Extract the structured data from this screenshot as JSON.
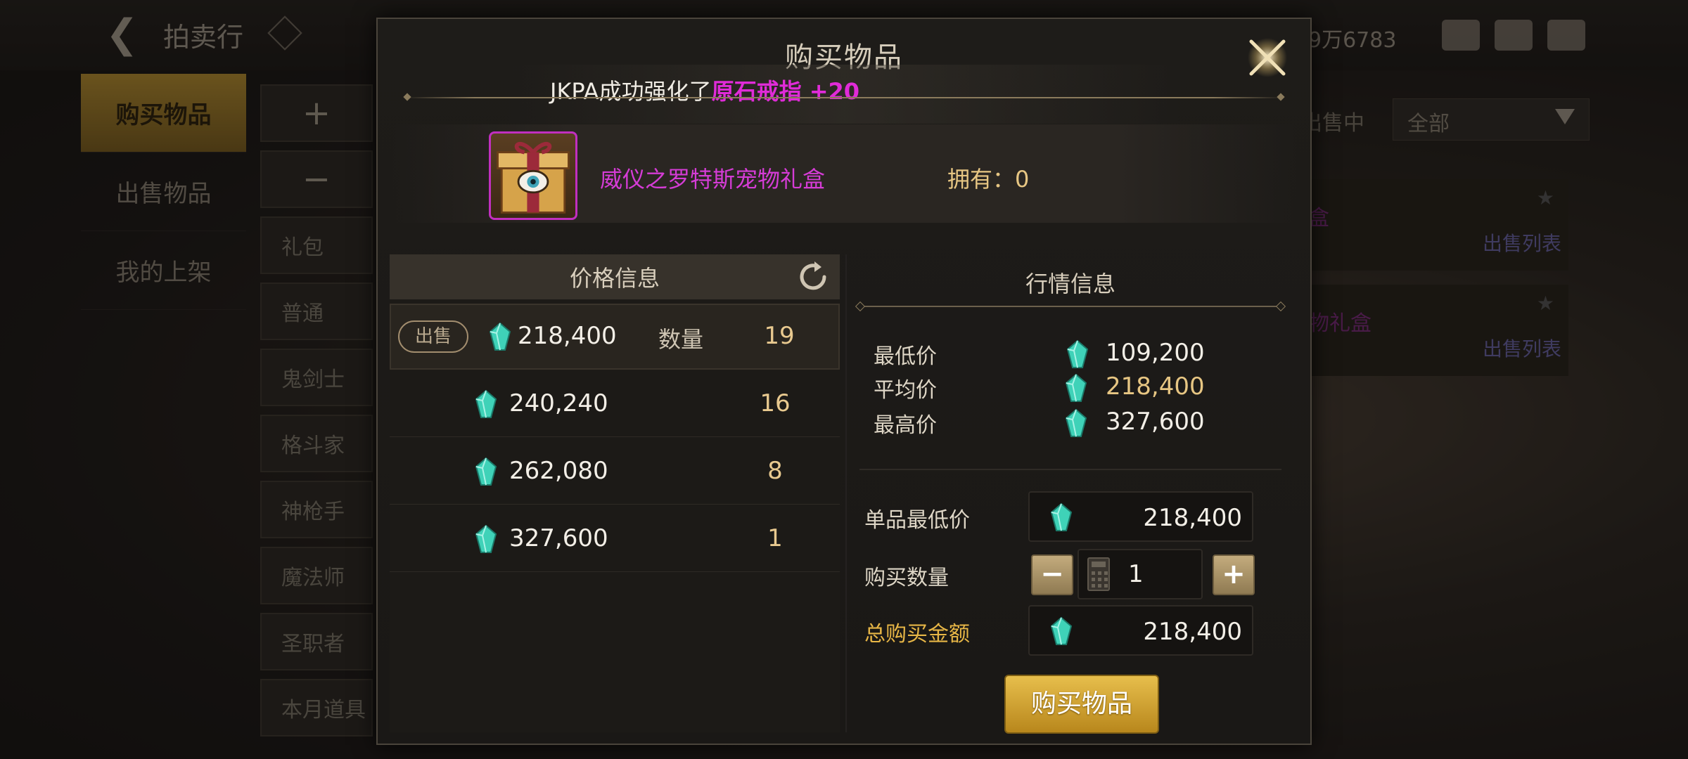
{
  "background": {
    "title": "拍卖行",
    "currency": "9万6783",
    "left_tabs": [
      "购买物品",
      "出售物品",
      "我的上架"
    ],
    "categories": [
      "+",
      "−",
      "礼包",
      "普通",
      "鬼剑士",
      "格斗家",
      "神枪手",
      "魔法师",
      "圣职者",
      "本月道具"
    ],
    "filter_label": "出售中",
    "filter_value": "全部",
    "rows": [
      {
        "name": "盒",
        "link": "出售列表"
      },
      {
        "name": "物礼盒",
        "link": "出售列表"
      }
    ]
  },
  "modal": {
    "title": "购买物品",
    "ticker_prefix": "JKPA成功强化了",
    "ticker_highlight": "原石戒指 +20",
    "item_name": "威仪之罗特斯宠物礼盒",
    "owned": "拥有：0"
  },
  "price_info": {
    "header": "价格信息",
    "sell_tag": "出售",
    "qty_label": "数量",
    "rows": [
      {
        "price": "218,400",
        "qty": "19"
      },
      {
        "price": "240,240",
        "qty": "16"
      },
      {
        "price": "262,080",
        "qty": "8"
      },
      {
        "price": "327,600",
        "qty": "1"
      }
    ]
  },
  "market_info": {
    "header": "行情信息",
    "min_label": "最低价",
    "min_value": "109,200",
    "avg_label": "平均价",
    "avg_value": "218,400",
    "max_label": "最高价",
    "max_value": "327,600"
  },
  "purchase": {
    "unit_min_label": "单品最低价",
    "unit_min_value": "218,400",
    "qty_label": "购买数量",
    "qty_value": "1",
    "minus": "−",
    "plus": "+",
    "total_label": "总购买金额",
    "total_value": "218,400",
    "buy_button": "购买物品"
  },
  "colors": {
    "gem": "#3fd2b8",
    "accent_gold": "#e7b646",
    "item_rarity": "#d53cd6"
  }
}
